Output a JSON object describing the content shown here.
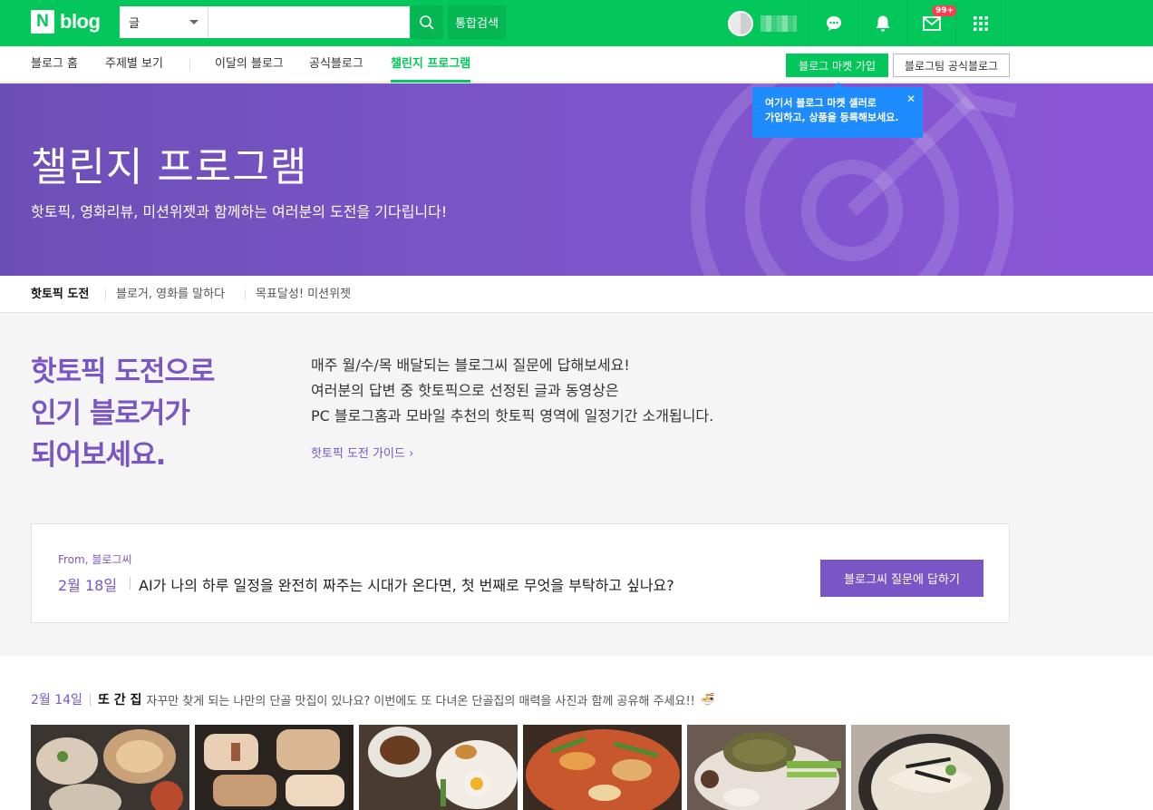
{
  "header": {
    "logo_n": "N",
    "logo_text": "blog",
    "search_scope": "글",
    "search_placeholder": "",
    "search_button": "통합검색",
    "mail_badge": "99+"
  },
  "subnav": {
    "items": [
      "블로그 홈",
      "주제별 보기",
      "이달의 블로그",
      "공식블로그",
      "챌린지 프로그램"
    ],
    "active_index": 4,
    "market_button": "블로그 마켓 가입",
    "team_button": "블로그팀 공식블로그"
  },
  "tooltip": {
    "line1": "여기서 블로그 마켓 셀러로",
    "line2": "가입하고, 상품을 등록해보세요."
  },
  "hero": {
    "title": "챌린지 프로그램",
    "subtitle": "핫토픽, 영화리뷰, 미션위젯과 함께하는 여러분의 도전을 기다립니다!"
  },
  "tabs": [
    "핫토픽 도전",
    "블로거, 영화를 말하다",
    "목표달성! 미션위젯"
  ],
  "intro": {
    "headline": [
      "핫토픽 도전으로",
      "인기 블로거가",
      "되어보세요."
    ],
    "description": [
      "매주 월/수/목 배달되는 블로그씨 질문에 답해보세요!",
      "여러분의 답변 중 핫토픽으로 선정된 글과 동영상은",
      "PC 블로그홈과 모바일 추천의 핫토픽 영역에 일정기간 소개됩니다."
    ],
    "guide_link": "핫토픽 도전 가이드 ›"
  },
  "question_card": {
    "from": "From, 블로그씨",
    "date": "2월 18일",
    "question": "AI가 나의 하루 일정을 완전히 짜주는 시대가 온다면, 첫 번째로 무엇을 부탁하고 싶나요?",
    "answer_button": "블로그씨 질문에 답하기"
  },
  "topic": {
    "date": "2월 14일",
    "title": "또 간 집",
    "text": "자꾸만 찾게 되는 나만의 단골 맛집이 있나요? 이번에도 또 다녀온 단골집의 매력을 사진과 함께 공유해 주세요!!",
    "emoji": "🍜"
  },
  "colors": {
    "brand_green": "#03c75a",
    "challenge_purple": "#7a55c6",
    "tooltip_blue": "#1e8bff"
  }
}
